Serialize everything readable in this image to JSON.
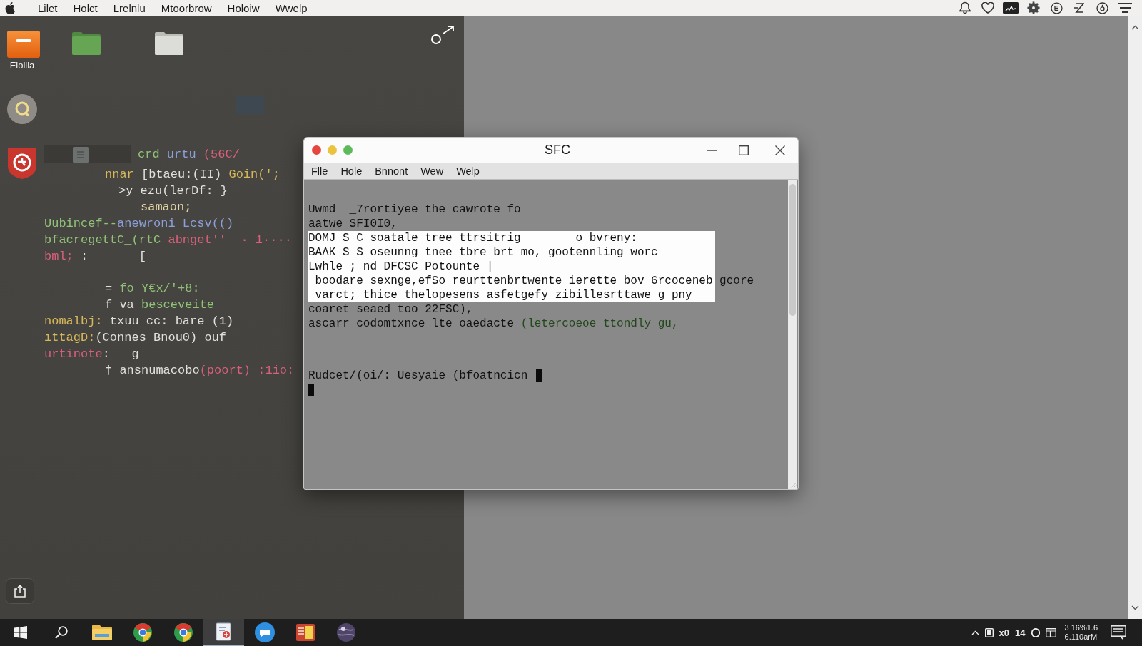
{
  "menu_bar": {
    "items": [
      "Lilet",
      "Holct",
      "Lrelnlu",
      "Mtoorbrow",
      "Holoiw",
      "Wwelp"
    ]
  },
  "desktop": {
    "shortcut_label": "Eloilla",
    "code": {
      "header": [
        {
          "text": "crd",
          "kind": "tag"
        },
        {
          "text": " urtu",
          "kind": "attr"
        },
        {
          "text": " (56C/",
          "kind": "error"
        }
      ],
      "blocks": [
        [
          {
            "kind": "nested",
            "segments": [
              {
                "text": "nnar",
                "kind": "keyword"
              },
              {
                "text": " [btaeu:(II)",
                "kind": "plain"
              },
              {
                "text": " Goin(';",
                "kind": "keyword"
              }
            ]
          },
          {
            "kind": "continuation",
            "segments": [
              {
                "text": ">y ezu(lerDf: }",
                "kind": "plain"
              }
            ]
          },
          {
            "kind": "body",
            "segments": [
              {
                "text": "samaon;",
                "kind": "variable"
              }
            ]
          },
          {
            "kind": "label",
            "segments": [
              {
                "text": "Uubincef--",
                "kind": "string"
              },
              {
                "text": "anewroni Lcsv(()",
                "kind": "type"
              }
            ]
          },
          {
            "kind": "label",
            "segments": [
              {
                "text": "bfacregettC_(rtC",
                "kind": "string"
              },
              {
                "text": " abnget''",
                "kind": "error"
              },
              {
                "text": "  · 1····",
                "kind": "error"
              }
            ]
          },
          {
            "kind": "label",
            "segments": [
              {
                "text": "bml;",
                "kind": "error"
              },
              {
                "text": " :       [",
                "kind": "plain"
              }
            ]
          }
        ],
        [
          {
            "kind": "nested",
            "segments": [
              {
                "text": "=",
                "kind": "plain"
              },
              {
                "text": " fo Y€x/'+8:",
                "kind": "string"
              }
            ]
          },
          {
            "kind": "nested",
            "segments": [
              {
                "text": "f va",
                "kind": "plain"
              },
              {
                "text": " besceveite",
                "kind": "string"
              }
            ]
          },
          {
            "kind": "label",
            "segments": [
              {
                "text": "nomalbj:",
                "kind": "keyword"
              },
              {
                "text": " txuu cc: bare (1)",
                "kind": "plain"
              }
            ]
          },
          {
            "kind": "label",
            "segments": [
              {
                "text": "ıttagD:",
                "kind": "keyword"
              },
              {
                "text": "(Connes Bnou0) ouf",
                "kind": "plain"
              }
            ]
          },
          {
            "kind": "label",
            "segments": [
              {
                "text": "urtinote",
                "kind": "error"
              },
              {
                "text": ":   g",
                "kind": "plain"
              }
            ]
          },
          {
            "kind": "nested",
            "segments": [
              {
                "text": "† ansnumacobo",
                "kind": "plain"
              },
              {
                "text": "(poort) :1io:",
                "kind": "error"
              }
            ]
          }
        ]
      ]
    }
  },
  "terminal": {
    "title": "SFC",
    "menu": [
      "Flle",
      "Hole",
      "Bnnont",
      "Wew",
      "Welp"
    ],
    "output": [
      {
        "selected": false,
        "segments": [
          {
            "text": "Uwmd  ",
            "kind": "plain"
          },
          {
            "text": "_7rortiyee",
            "kind": "link"
          },
          {
            "text": " the cawrote fo",
            "kind": "plain"
          }
        ]
      },
      {
        "selected": false,
        "segments": [
          {
            "text": "aatwe SFI0I0,",
            "kind": "plain"
          }
        ]
      },
      {
        "selected": true,
        "segments": [
          {
            "text": "DOMJ S C soatale tree ttrsitrig        o bvreny:",
            "kind": "plain"
          }
        ]
      },
      {
        "selected": true,
        "segments": [
          {
            "text": "BAΛK S S oseunng tnee tbre brt mo, gootennling worc",
            "kind": "plain"
          }
        ]
      },
      {
        "selected": true,
        "segments": [
          {
            "text": "Lwhle ; nd DFCSC Potounte |",
            "kind": "plain"
          }
        ]
      },
      {
        "selected": true,
        "segments": [
          {
            "text": " boodare sexnge,efSo reurttenbrtwente ierette bov 6rcoceneb gcore",
            "kind": "plain"
          }
        ]
      },
      {
        "selected": true,
        "segments": [
          {
            "text": " varct; thice thelopesens asfetgefy zibillesrttawe g pny",
            "kind": "plain"
          }
        ]
      },
      {
        "selected": false,
        "segments": [
          {
            "text": "coaret seaed too 22FSC),",
            "kind": "plain"
          }
        ]
      },
      {
        "selected": false,
        "segments": [
          {
            "text": "ascarr codomtxnce lte oaedacte ",
            "kind": "plain"
          },
          {
            "text": "(letercoeoe ttondly gu,",
            "kind": "comment"
          }
        ]
      }
    ],
    "prompt": "Rudcet/(oi/: Uesyaie (bfoatncicn"
  },
  "taskbar": {
    "items": [
      {
        "kind": "start",
        "selected": false
      },
      {
        "kind": "search",
        "selected": false
      },
      {
        "kind": "files",
        "selected": false
      },
      {
        "kind": "browser",
        "selected": false
      },
      {
        "kind": "browser",
        "selected": false
      },
      {
        "kind": "document",
        "selected": true
      },
      {
        "kind": "chat",
        "selected": false
      },
      {
        "kind": "notes",
        "selected": false
      },
      {
        "kind": "globe",
        "selected": false
      }
    ],
    "tray_texts": [
      "x0",
      "14"
    ],
    "clock": [
      "3 16%1.6",
      "6.110arM"
    ]
  }
}
